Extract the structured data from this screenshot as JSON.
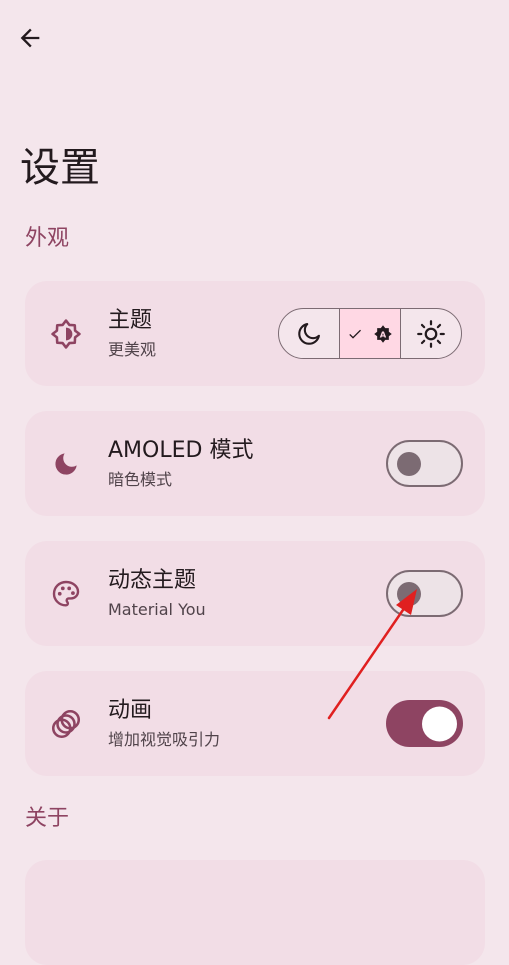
{
  "header": {
    "title": "设置",
    "back_icon": "arrow-back-icon"
  },
  "sections": {
    "appearance_title": "外观",
    "about_title": "关于"
  },
  "settings": [
    {
      "title": "主题",
      "subtitle": "更美观",
      "icon": "brightness-icon",
      "control": "segmented",
      "options": [
        "dark",
        "auto",
        "light"
      ],
      "selected": "auto"
    },
    {
      "title": "AMOLED 模式",
      "subtitle": "暗色模式",
      "icon": "moon-icon",
      "control": "switch",
      "checked": false
    },
    {
      "title": "动态主题",
      "subtitle": "Material You",
      "icon": "palette-icon",
      "control": "switch",
      "checked": false
    },
    {
      "title": "动画",
      "subtitle": "增加视觉吸引力",
      "icon": "animation-icon",
      "control": "switch",
      "checked": true
    }
  ],
  "colors": {
    "background": "#f4e6ec",
    "card": "#f2dde6",
    "accent": "#8e4462",
    "selected_segment": "#ffd8e4",
    "annotation_arrow": "#e02020"
  }
}
